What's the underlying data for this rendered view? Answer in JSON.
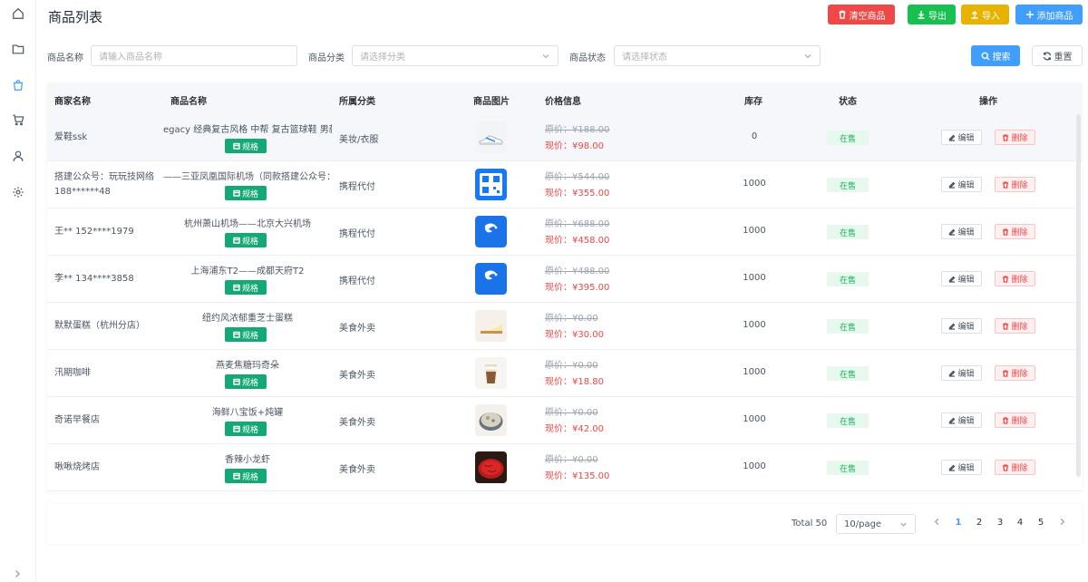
{
  "page": {
    "title": "商品列表"
  },
  "toolbar": {
    "clear_label": "清空商品",
    "export_label": "导出",
    "import_label": "导入",
    "add_label": "添加商品",
    "colors": {
      "clear": "#f04747",
      "export": "#18c050",
      "import": "#e7b300",
      "add": "#409eff"
    }
  },
  "filters": {
    "name_label": "商品名称",
    "name_placeholder": "请输入商品名称",
    "category_label": "商品分类",
    "category_placeholder": "请选择分类",
    "status_label": "商品状态",
    "status_placeholder": "请选择状态",
    "search_label": "搜索",
    "reset_label": "重置"
  },
  "table": {
    "headers": {
      "merchant": "商家名称",
      "name": "商品名称",
      "category": "所属分类",
      "image": "商品图片",
      "price": "价格信息",
      "stock": "库存",
      "status": "状态",
      "actions": "操作"
    },
    "spec_label": "规格",
    "edit_label": "编辑",
    "delete_label": "删除",
    "orig_prefix": "原价：",
    "curr_prefix": "现价：",
    "rows": [
      {
        "merchant": "爱鞋ssk",
        "name": "egacy 经典复古风格 中帮 复古篮球鞋 男款",
        "category": "美妆/衣服",
        "orig": "¥188.00",
        "curr": "¥98.00",
        "stock": "0",
        "status": "在售",
        "image": "sneaker"
      },
      {
        "merchant": "搭建公众号：玩玩技网络188******48",
        "name": "——三亚凤凰国际机场（同款搭建公众号：",
        "category": "携程代付",
        "orig": "¥544.00",
        "curr": "¥355.00",
        "stock": "1000",
        "status": "在售",
        "image": "qr-ticket"
      },
      {
        "merchant": "王** 152****1979",
        "name": "杭州萧山机场——北京大兴机场",
        "category": "携程代付",
        "orig": "¥688.00",
        "curr": "¥458.00",
        "stock": "1000",
        "status": "在售",
        "image": "ctrip",
        "image_text": "携程"
      },
      {
        "merchant": "李** 134****3858",
        "name": "上海浦东T2——成都天府T2",
        "category": "携程代付",
        "orig": "¥488.00",
        "curr": "¥395.00",
        "stock": "1000",
        "status": "在售",
        "image": "ctrip",
        "image_text": "携程"
      },
      {
        "merchant": "默默蛋糕（杭州分店）",
        "name": "纽约风浓郁重芝士蛋糕",
        "category": "美食外卖",
        "orig": "¥0.00",
        "curr": "¥30.00",
        "stock": "1000",
        "status": "在售",
        "image": "cheesecake"
      },
      {
        "merchant": "汛期咖啡",
        "name": "燕麦焦糖玛奇朵",
        "category": "美食外卖",
        "orig": "¥0.00",
        "curr": "¥18.80",
        "stock": "1000",
        "status": "在售",
        "image": "coffee"
      },
      {
        "merchant": "奇诺早餐店",
        "name": "海鲜八宝饭+炖罐",
        "category": "美食外卖",
        "orig": "¥0.00",
        "curr": "¥42.00",
        "stock": "1000",
        "status": "在售",
        "image": "rice"
      },
      {
        "merchant": "啾啾烧烤店",
        "name": "香辣小龙虾",
        "category": "美食外卖",
        "orig": "¥0.00",
        "curr": "¥135.00",
        "stock": "1000",
        "status": "在售",
        "image": "crayfish"
      }
    ]
  },
  "pagination": {
    "total": "Total 50",
    "page_size": "10/page",
    "pages": [
      "1",
      "2",
      "3",
      "4",
      "5"
    ],
    "current": "1"
  }
}
